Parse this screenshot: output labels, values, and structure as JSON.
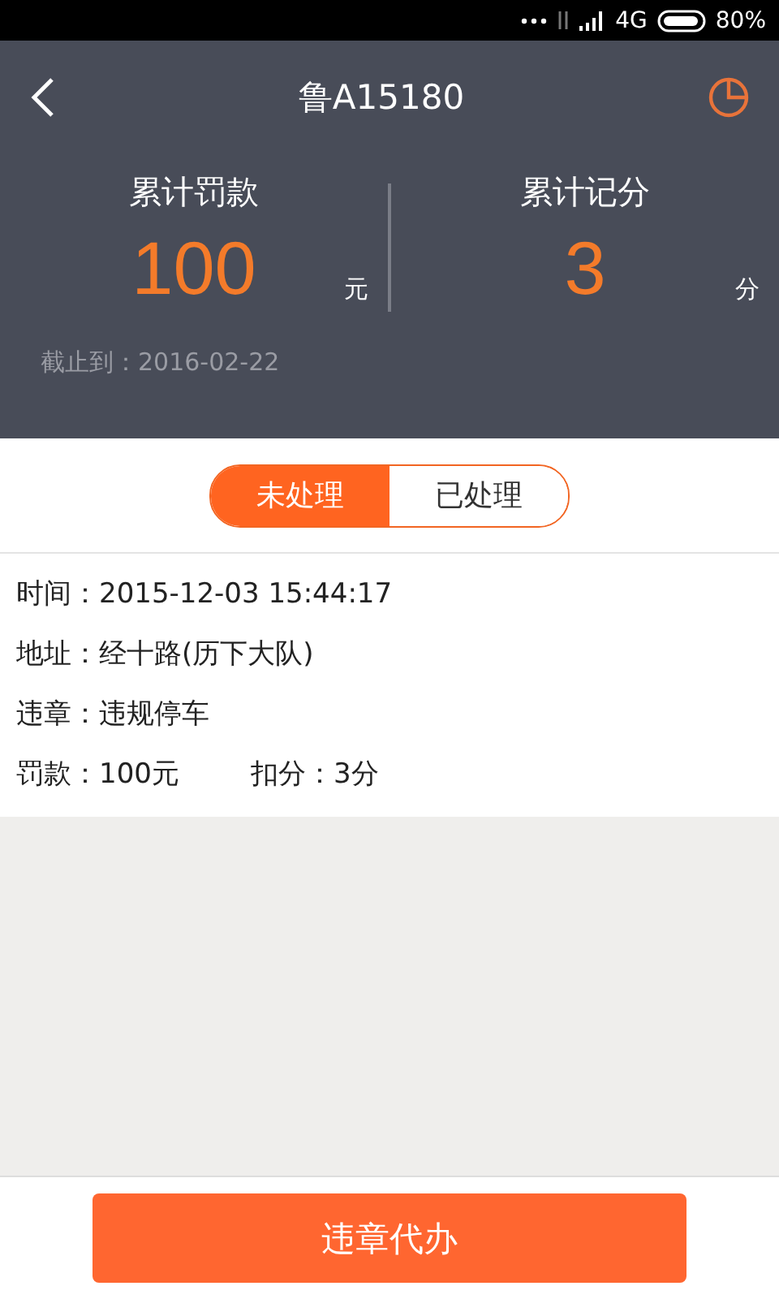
{
  "status_bar": {
    "network": "4G",
    "battery": "80%"
  },
  "header": {
    "title": "鲁A15180"
  },
  "summary": [
    {
      "label": "累计罚款",
      "value": "100",
      "unit": "元"
    },
    {
      "label": "累计记分",
      "value": "3",
      "unit": "分"
    }
  ],
  "cutoff": "截止到：2016-02-22",
  "tabs": [
    {
      "label": "未处理",
      "selected": true
    },
    {
      "label": "已处理",
      "selected": false
    }
  ],
  "record": [
    [
      "时间：2015-12-03 15:44:17"
    ],
    [
      "地址：经十路(历下大队)"
    ],
    [
      "违章：违规停车"
    ],
    [
      "罚款：100元",
      "扣分：3分"
    ]
  ],
  "action_button": "违章代办"
}
